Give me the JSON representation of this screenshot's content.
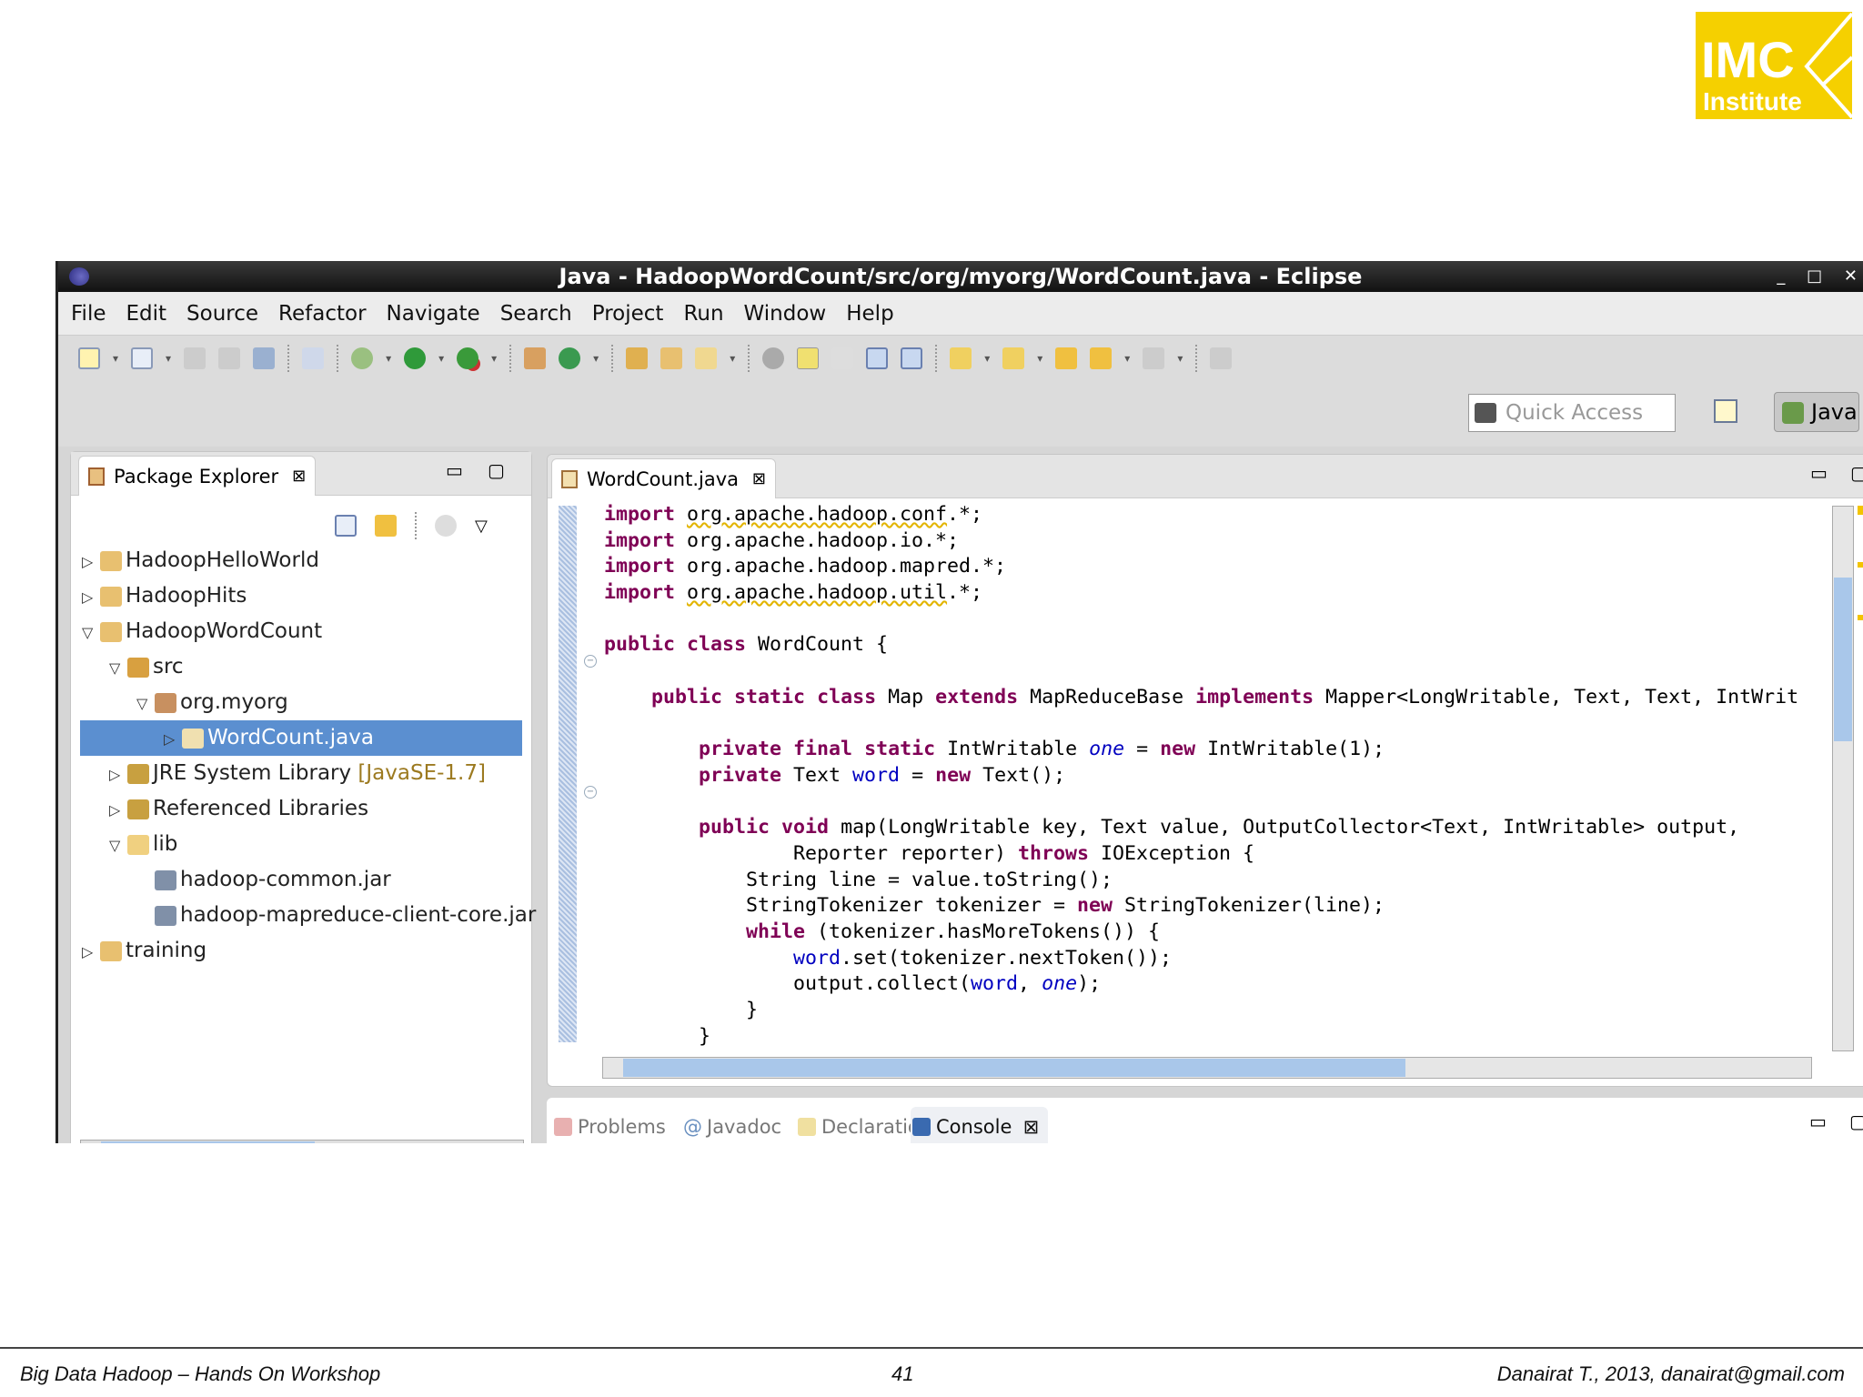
{
  "logo": {
    "line1": "IMC",
    "line2": "Institute",
    "color": "#f5d000"
  },
  "window": {
    "title": "Java - HadoopWordCount/src/org/myorg/WordCount.java - Eclipse",
    "controls": [
      "_",
      "□",
      "✕"
    ]
  },
  "menu": [
    "File",
    "Edit",
    "Source",
    "Refactor",
    "Navigate",
    "Search",
    "Project",
    "Run",
    "Window",
    "Help"
  ],
  "quick_access": {
    "placeholder": "Quick Access"
  },
  "perspective": {
    "label": "Java"
  },
  "package_explorer": {
    "title": "Package Explorer",
    "tree": [
      {
        "label": "HadoopHelloWorld",
        "depth": 0,
        "twisty": "▷",
        "icon": "project"
      },
      {
        "label": "HadoopHits",
        "depth": 0,
        "twisty": "▷",
        "icon": "project"
      },
      {
        "label": "HadoopWordCount",
        "depth": 0,
        "twisty": "▽",
        "icon": "project"
      },
      {
        "label": "src",
        "depth": 1,
        "twisty": "▽",
        "icon": "source-folder"
      },
      {
        "label": "org.myorg",
        "depth": 2,
        "twisty": "▽",
        "icon": "package"
      },
      {
        "label": "WordCount.java",
        "depth": 3,
        "twisty": "▷",
        "icon": "java-file",
        "selected": true
      },
      {
        "label": "JRE System Library",
        "decoration": "[JavaSE-1.7]",
        "depth": 1,
        "twisty": "▷",
        "icon": "library"
      },
      {
        "label": "Referenced Libraries",
        "depth": 1,
        "twisty": "▷",
        "icon": "library"
      },
      {
        "label": "lib",
        "depth": 1,
        "twisty": "▽",
        "icon": "folder"
      },
      {
        "label": "hadoop-common.jar",
        "depth": 2,
        "twisty": "",
        "icon": "jar"
      },
      {
        "label": "hadoop-mapreduce-client-core.jar",
        "depth": 2,
        "twisty": "",
        "icon": "jar"
      },
      {
        "label": "training",
        "depth": 0,
        "twisty": "▷",
        "icon": "project"
      }
    ]
  },
  "editor": {
    "tab": "WordCount.java",
    "lines": [
      [
        [
          "import",
          "kw"
        ],
        [
          " "
        ],
        [
          "org.apache.hadoop.conf",
          "warn"
        ],
        [
          ".*;"
        ]
      ],
      [
        [
          "import",
          "kw"
        ],
        [
          " org.apache.hadoop.io.*;"
        ]
      ],
      [
        [
          "import",
          "kw"
        ],
        [
          " org.apache.hadoop.mapred.*;"
        ]
      ],
      [
        [
          "import",
          "kw"
        ],
        [
          " "
        ],
        [
          "org.apache.hadoop.util",
          "warn"
        ],
        [
          ".*;"
        ]
      ],
      [],
      [
        [
          "public",
          "kw"
        ],
        [
          " "
        ],
        [
          "class",
          "kw"
        ],
        [
          " WordCount {"
        ]
      ],
      [],
      [
        [
          "    "
        ],
        [
          "public",
          "kw"
        ],
        [
          " "
        ],
        [
          "static",
          "kw"
        ],
        [
          " "
        ],
        [
          "class",
          "kw"
        ],
        [
          " Map "
        ],
        [
          "extends",
          "kw"
        ],
        [
          " MapReduceBase "
        ],
        [
          "implements",
          "kw"
        ],
        [
          " Mapper<LongWritable, Text, Text, IntWrit"
        ]
      ],
      [],
      [
        [
          "        "
        ],
        [
          "private",
          "kw"
        ],
        [
          " "
        ],
        [
          "final",
          "kw"
        ],
        [
          " "
        ],
        [
          "static",
          "kw"
        ],
        [
          " IntWritable "
        ],
        [
          "one",
          "sfld"
        ],
        [
          " = "
        ],
        [
          "new",
          "kw"
        ],
        [
          " IntWritable(1);"
        ]
      ],
      [
        [
          "        "
        ],
        [
          "private",
          "kw"
        ],
        [
          " Text "
        ],
        [
          "word",
          "fld"
        ],
        [
          " = "
        ],
        [
          "new",
          "kw"
        ],
        [
          " Text();"
        ]
      ],
      [],
      [
        [
          "        "
        ],
        [
          "public",
          "kw"
        ],
        [
          " "
        ],
        [
          "void",
          "kw"
        ],
        [
          " map(LongWritable key, Text value, OutputCollector<Text, IntWritable> output,"
        ]
      ],
      [
        [
          "                Reporter reporter) "
        ],
        [
          "throws",
          "kw"
        ],
        [
          " IOException {"
        ]
      ],
      [
        [
          "            String line = value.toString();"
        ]
      ],
      [
        [
          "            StringTokenizer tokenizer = "
        ],
        [
          "new",
          "kw"
        ],
        [
          " StringTokenizer(line);"
        ]
      ],
      [
        [
          "            "
        ],
        [
          "while",
          "kw"
        ],
        [
          " (tokenizer.hasMoreTokens()) {"
        ]
      ],
      [
        [
          "                "
        ],
        [
          "word",
          "fld"
        ],
        [
          ".set(tokenizer.nextToken());"
        ]
      ],
      [
        [
          "                output.collect("
        ],
        [
          "word",
          "fld"
        ],
        [
          ", "
        ],
        [
          "one",
          "sfld"
        ],
        [
          ");"
        ]
      ],
      [
        [
          "            }"
        ]
      ],
      [
        [
          "        }"
        ]
      ]
    ]
  },
  "bottom_tabs": [
    {
      "label": "Problems",
      "active": false
    },
    {
      "label": "Javadoc",
      "active": false
    },
    {
      "label": "Declaration",
      "active": false
    },
    {
      "label": "Console",
      "active": true
    }
  ],
  "footer": {
    "left": "Big Data Hadoop – Hands On Workshop",
    "page": "41",
    "right": "Danairat T., 2013, danairat@gmail.com"
  }
}
